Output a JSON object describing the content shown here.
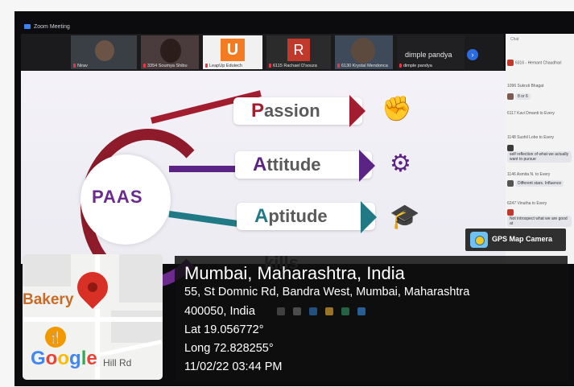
{
  "zoom_window": {
    "title": "Zoom Meeting",
    "participants": [
      {
        "name": "Nirav"
      },
      {
        "name": "3354 Soumya Shibu"
      },
      {
        "name": "LeapUp Edutech"
      },
      {
        "name": "6115 Rachael D'souza",
        "initial": "R"
      },
      {
        "name": "6130 Krystal Mendonca"
      },
      {
        "name": "dimple pandya"
      }
    ],
    "featured_name": "dimple pandya"
  },
  "slide": {
    "center": "PAAS",
    "items": [
      {
        "label": "Passion",
        "first": "P",
        "rest": "assion",
        "color": "#a21d2e",
        "icon": "raised-fist-icon"
      },
      {
        "label": "Attitude",
        "first": "A",
        "rest": "ttitude",
        "color": "#5b2383",
        "icon": "head-gears-icon"
      },
      {
        "label": "Aptitude",
        "first": "A",
        "rest": "ptitude",
        "color": "#1f7a86",
        "icon": "graduation-cap-icon"
      }
    ],
    "partial": "kills"
  },
  "chat": {
    "header": "Chat",
    "messages": [
      {
        "text": "6316 - Hemant Chaudhari"
      },
      {
        "text": "1096 Sukruti Bhagat"
      },
      {
        "text": "8 or 6"
      },
      {
        "text": "6117 Kavi Dmanti to Every"
      },
      {
        "text": "1148 Sushil Lobo to Every"
      },
      {
        "text": "self reflection of what we actually want to pursue"
      },
      {
        "text": "1146 Asmita N. to Every"
      },
      {
        "text": "Different stars. Influence"
      },
      {
        "text": "6247 Vinutha to Every"
      },
      {
        "text": "Not introspect what we are good at"
      }
    ]
  },
  "gps_stamp": {
    "app_name": "GPS Map Camera",
    "location": "Mumbai, Maharashtra, India",
    "address_line1": "55, St Domnic Rd, Bandra West, Mumbai, Maharashtra",
    "address_line2": "400050, India",
    "lat": "Lat 19.056772°",
    "long": "Long 72.828255°",
    "datetime": "11/02/22 03:44 PM",
    "map": {
      "poi": "Bakery",
      "street": "Hill Rd",
      "brand": "Google"
    }
  },
  "colors": {
    "pin": "#d93025",
    "overlay": "#0f0f0f",
    "gps_logo": "#6ec1f0"
  }
}
